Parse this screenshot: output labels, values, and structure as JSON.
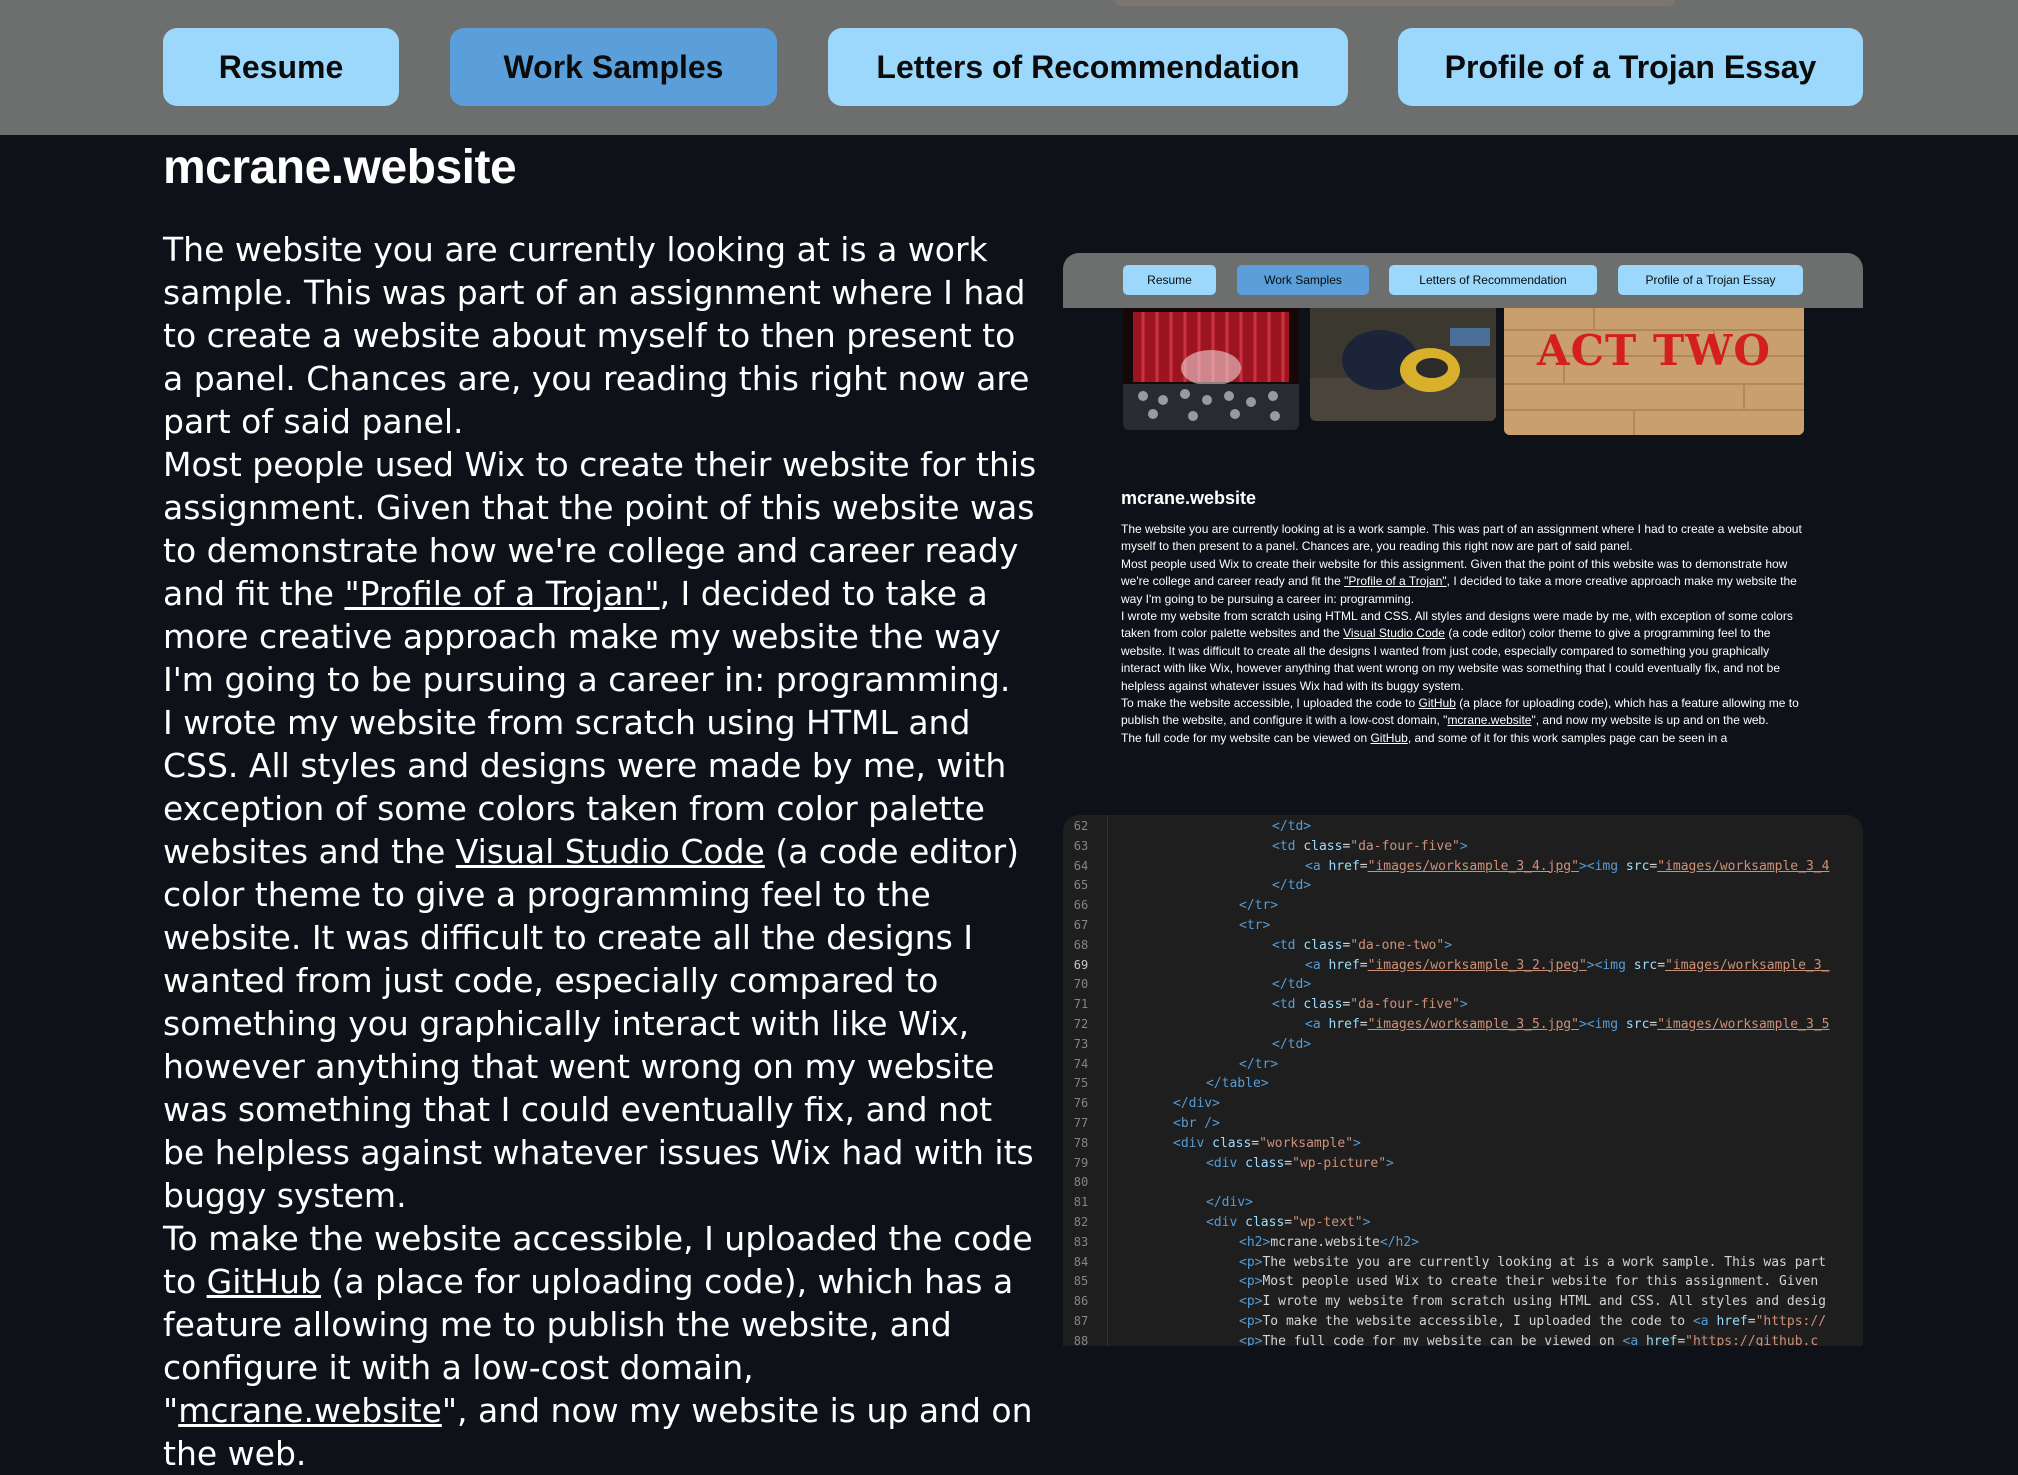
{
  "nav": {
    "buttons": [
      "Resume",
      "Work Samples",
      "Letters of Recommendation",
      "Profile of a Trojan Essay"
    ],
    "active": "Work Samples"
  },
  "sample": {
    "title": "mcrane.website",
    "p1": "The website you are currently looking at is a work sample. This was part of an assignment where I had to create a website about myself to then present to a panel. Chances are, you reading this right now are part of said panel.",
    "p2_before": "Most people used Wix to create their website for this assignment. Given that the point of this website was to demonstrate how we're college and career ready and fit the ",
    "p2_link": "\"Profile of a Trojan\"",
    "p2_after": ", I decided to take a more creative approach make my website the way I'm going to be pursuing a career in: programming.",
    "p3_before": "I wrote my website from scratch using HTML and CSS. All styles and designs were made by me, with exception of some colors taken from color palette websites and the ",
    "p3_link": "Visual Studio Code",
    "p3_after": " (a code editor) color theme to give a programming feel to the website. It was difficult to create all the designs I wanted from just code, especially compared to something you graphically interact with like Wix, however anything that went wrong on my website was something that I could eventually fix, and not be helpless against whatever issues Wix had with its buggy system.",
    "p4_before": "To make the website accessible, I uploaded the code to ",
    "p4_link": "GitHub",
    "p4_mid": " (a place for uploading code), which has a feature allowing me to publish the website, and configure it with a low-cost domain, \"",
    "p4_link2": "mcrane.website",
    "p4_after": "\", and now my website is up and on the web.",
    "p5_before": "The full code for my website can be viewed on ",
    "p5_link": "GitHub",
    "p5_after": ", and some of it for this work samples page can be seen in a"
  },
  "screenshot": {
    "act_two_label": "ACT TWO"
  },
  "code_view": {
    "lines": [
      {
        "n": "62",
        "indent": 5,
        "html": "<span class=\"tag\">&lt;/td&gt;</span>"
      },
      {
        "n": "63",
        "indent": 5,
        "html": "<span class=\"tag\">&lt;td</span> <span class=\"attr\">class</span>=<span class=\"strp\">\"da-four-five\"</span><span class=\"tag\">&gt;</span>"
      },
      {
        "n": "64",
        "indent": 6,
        "html": "<span class=\"tag\">&lt;a</span> <span class=\"attr\">href</span>=<span class=\"str\">\"images/worksample_3_4.jpg\"</span><span class=\"tag\">&gt;&lt;img</span> <span class=\"attr\">src</span>=<span class=\"str\">\"images/worksample_3_4</span>"
      },
      {
        "n": "65",
        "indent": 5,
        "html": "<span class=\"tag\">&lt;/td&gt;</span>"
      },
      {
        "n": "66",
        "indent": 4,
        "html": "<span class=\"tag\">&lt;/tr&gt;</span>"
      },
      {
        "n": "67",
        "indent": 4,
        "html": "<span class=\"tag\">&lt;tr&gt;</span>"
      },
      {
        "n": "68",
        "indent": 5,
        "html": "<span class=\"tag\">&lt;td</span> <span class=\"attr\">class</span>=<span class=\"strp\">\"da-one-two\"</span><span class=\"tag\">&gt;</span>"
      },
      {
        "n": "69",
        "indent": 6,
        "html": "<span class=\"tag\">&lt;a</span> <span class=\"attr\">href</span>=<span class=\"str\">\"images/worksample_3_2.jpeg\"</span><span class=\"tag\">&gt;&lt;img</span> <span class=\"attr\">src</span>=<span class=\"str\">\"images/worksample_3_</span>"
      },
      {
        "n": "70",
        "indent": 5,
        "html": "<span class=\"tag\">&lt;/td&gt;</span>"
      },
      {
        "n": "71",
        "indent": 5,
        "html": "<span class=\"tag\">&lt;td</span> <span class=\"attr\">class</span>=<span class=\"strp\">\"da-four-five\"</span><span class=\"tag\">&gt;</span>"
      },
      {
        "n": "72",
        "indent": 6,
        "html": "<span class=\"tag\">&lt;a</span> <span class=\"attr\">href</span>=<span class=\"str\">\"images/worksample_3_5.jpg\"</span><span class=\"tag\">&gt;&lt;img</span> <span class=\"attr\">src</span>=<span class=\"str\">\"images/worksample_3_5</span>"
      },
      {
        "n": "73",
        "indent": 5,
        "html": "<span class=\"tag\">&lt;/td&gt;</span>"
      },
      {
        "n": "74",
        "indent": 4,
        "html": "<span class=\"tag\">&lt;/tr&gt;</span>"
      },
      {
        "n": "75",
        "indent": 3,
        "html": "<span class=\"tag\">&lt;/table&gt;</span>"
      },
      {
        "n": "76",
        "indent": 2,
        "html": "<span class=\"tag\">&lt;/div&gt;</span>"
      },
      {
        "n": "77",
        "indent": 2,
        "html": "<span class=\"tag\">&lt;br /&gt;</span>"
      },
      {
        "n": "78",
        "indent": 2,
        "html": "<span class=\"tag\">&lt;div</span> <span class=\"attr\">class</span>=<span class=\"strp\">\"worksample\"</span><span class=\"tag\">&gt;</span>"
      },
      {
        "n": "79",
        "indent": 3,
        "html": "<span class=\"tag\">&lt;div</span> <span class=\"attr\">class</span>=<span class=\"strp\">\"wp-picture\"</span><span class=\"tag\">&gt;</span>"
      },
      {
        "n": "80",
        "indent": 0,
        "html": ""
      },
      {
        "n": "81",
        "indent": 3,
        "html": "<span class=\"tag\">&lt;/div&gt;</span>"
      },
      {
        "n": "82",
        "indent": 3,
        "html": "<span class=\"tag\">&lt;div</span> <span class=\"attr\">class</span>=<span class=\"strp\">\"wp-text\"</span><span class=\"tag\">&gt;</span>"
      },
      {
        "n": "83",
        "indent": 4,
        "html": "<span class=\"tag\">&lt;h2&gt;</span><span class=\"txt\">mcrane.website</span><span class=\"tag\">&lt;/h2&gt;</span>"
      },
      {
        "n": "84",
        "indent": 4,
        "html": "<span class=\"tag\">&lt;p&gt;</span><span class=\"txt\">The website you are currently looking at is a work sample. This was part</span>"
      },
      {
        "n": "85",
        "indent": 4,
        "html": "<span class=\"tag\">&lt;p&gt;</span><span class=\"txt\">Most people used Wix to create their website for this assignment. Given</span>"
      },
      {
        "n": "86",
        "indent": 4,
        "html": "<span class=\"tag\">&lt;p&gt;</span><span class=\"txt\">I wrote my website from scratch using HTML and CSS. All styles and desig</span>"
      },
      {
        "n": "87",
        "indent": 4,
        "html": "<span class=\"tag\">&lt;p&gt;</span><span class=\"txt\">To make the website accessible, I uploaded the code to </span><span class=\"tag\">&lt;a</span> <span class=\"attr\">href</span>=<span class=\"strp\">\"https://</span>"
      },
      {
        "n": "88",
        "indent": 4,
        "html": "<span class=\"tag\">&lt;p&gt;</span><span class=\"txt\">The full code for my website can be viewed on </span><span class=\"tag\">&lt;a</span> <span class=\"attr\">href</span>=<span class=\"strp\">\"https://github.c</span>"
      }
    ]
  }
}
